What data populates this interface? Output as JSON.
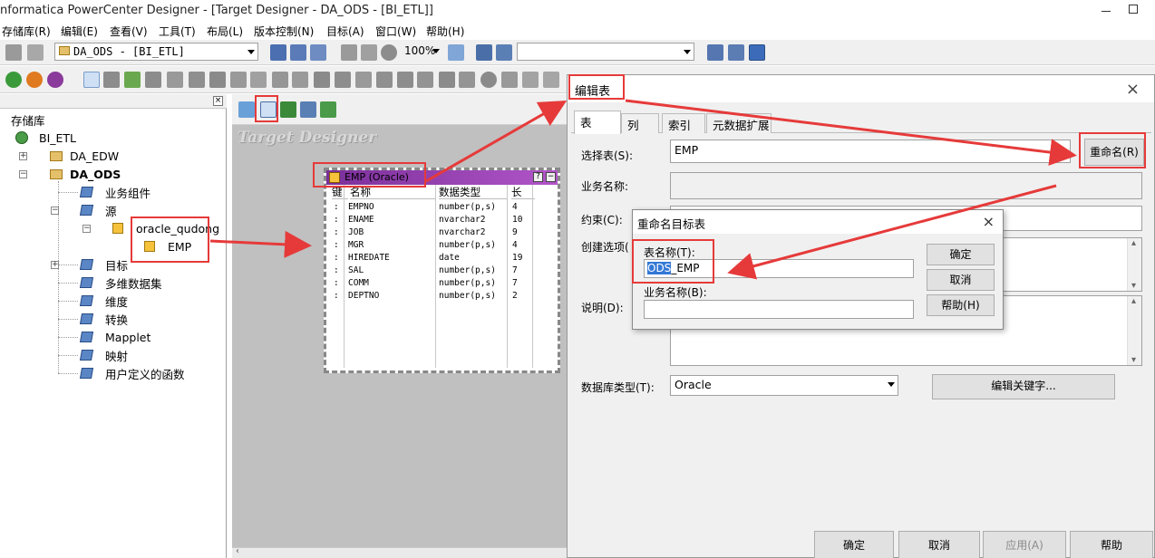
{
  "app": {
    "title": "nformatica PowerCenter Designer - [Target Designer - DA_ODS - [BI_ETL]]"
  },
  "menu": [
    "存储库(R)",
    "编辑(E)",
    "查看(V)",
    "工具(T)",
    "布局(L)",
    "版本控制(N)",
    "目标(A)",
    "窗口(W)",
    "帮助(H)"
  ],
  "toolbar": {
    "folder_combo": "DA_ODS - [BI_ETL]",
    "zoom": "100%",
    "search_combo": ""
  },
  "navigator": {
    "root": "存储库",
    "repo": "BI_ETL",
    "folders": [
      "DA_EDW",
      "DA_ODS"
    ],
    "nodes": {
      "business_components": "业务组件",
      "sources": "源",
      "oracle_db": "oracle_qudong",
      "emp": "EMP",
      "targets": "目标",
      "cubes": "多维数据集",
      "dimensions": "维度",
      "transformations": "转换",
      "mapplet": "Mapplet",
      "mappings": "映射",
      "udf": "用户定义的函数"
    }
  },
  "workspace": {
    "title": "Target Designer",
    "table": {
      "name": "EMP (Oracle)",
      "columns": [
        "键",
        "名称",
        "数据类型",
        "长"
      ],
      "rows": [
        {
          "name": "EMPNO",
          "type": "number(p,s)",
          "len": "4"
        },
        {
          "name": "ENAME",
          "type": "nvarchar2",
          "len": "10"
        },
        {
          "name": "JOB",
          "type": "nvarchar2",
          "len": "9"
        },
        {
          "name": "MGR",
          "type": "number(p,s)",
          "len": "4"
        },
        {
          "name": "HIREDATE",
          "type": "date",
          "len": "19"
        },
        {
          "name": "SAL",
          "type": "number(p,s)",
          "len": "7"
        },
        {
          "name": "COMM",
          "type": "number(p,s)",
          "len": "7"
        },
        {
          "name": "DEPTNO",
          "type": "number(p,s)",
          "len": "2"
        }
      ]
    }
  },
  "edit_dialog": {
    "title": "编辑表",
    "tabs": [
      "表",
      "列",
      "索引",
      "元数据扩展"
    ],
    "select_table_label": "选择表(S):",
    "select_table_value": "EMP",
    "rename_button": "重命名(R)",
    "business_name_label": "业务名称:",
    "constraint_label": "约束(C):",
    "create_options_label": "创建选项(",
    "description_label": "说明(D):",
    "db_type_label": "数据库类型(T):",
    "db_type_value": "Oracle",
    "edit_keywords_button": "编辑关键字...",
    "ok": "确定",
    "cancel": "取消",
    "apply": "应用(A)",
    "help": "帮助"
  },
  "rename_dialog": {
    "title": "重命名目标表",
    "table_name_label": "表名称(T):",
    "table_name_selected": "ODS",
    "table_name_rest": "_EMP",
    "business_name_label": "业务名称(B):",
    "business_name_value": "",
    "ok": "确定",
    "cancel": "取消",
    "help": "帮助(H)"
  }
}
